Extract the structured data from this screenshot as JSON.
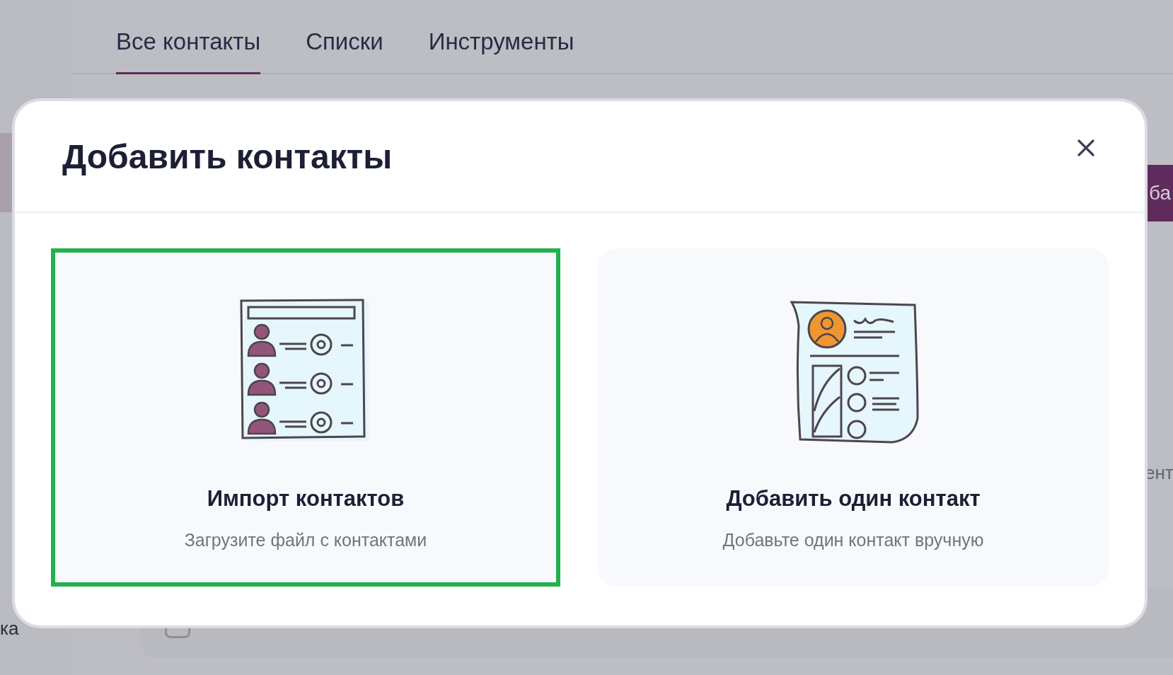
{
  "tabs": [
    {
      "label": "Все контакты",
      "selected": true
    },
    {
      "label": "Списки",
      "selected": false
    },
    {
      "label": "Инструменты",
      "selected": false
    }
  ],
  "background": {
    "sidebar_fragment": "ка",
    "button_fragment": "ба",
    "side_fragment": "ент",
    "checkbox_checked": false
  },
  "modal": {
    "title": "Добавить контакты",
    "options": [
      {
        "kind": "import",
        "title": "Импорт контактов",
        "description": "Загрузите файл с контактами",
        "selected": true
      },
      {
        "kind": "single",
        "title": "Добавить один контакт",
        "description": "Добавьте один контакт вручную",
        "selected": false
      }
    ]
  }
}
